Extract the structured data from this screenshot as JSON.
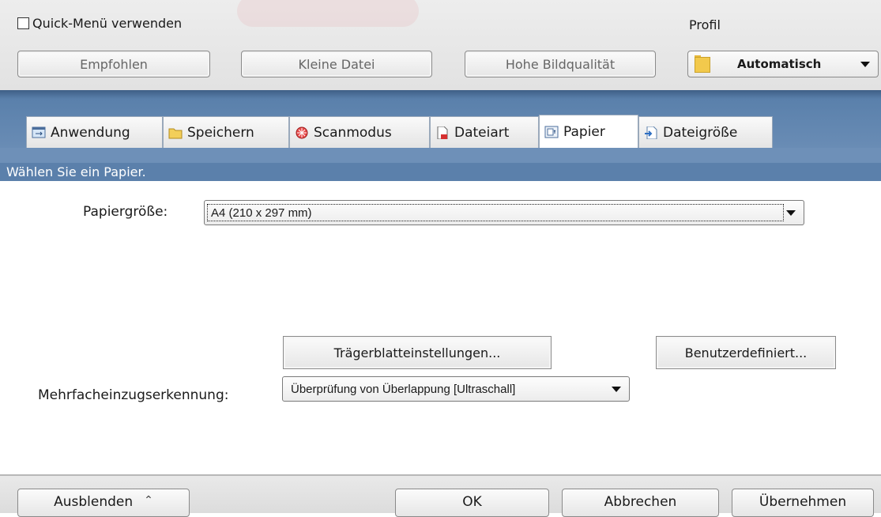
{
  "top": {
    "quick_menu_label": "Quick-Menü verwenden",
    "profile_label": "Profil",
    "presets": [
      "Empfohlen",
      "Kleine Datei",
      "Hohe Bildqualität"
    ],
    "profile_value": "Automatisch"
  },
  "tabs": [
    {
      "label": "Anwendung",
      "icon": "application-icon"
    },
    {
      "label": "Speichern",
      "icon": "folder-icon"
    },
    {
      "label": "Scanmodus",
      "icon": "scanmode-icon"
    },
    {
      "label": "Dateiart",
      "icon": "file-type-icon"
    },
    {
      "label": "Papier",
      "icon": "paper-icon"
    },
    {
      "label": "Dateigröße",
      "icon": "file-size-icon"
    }
  ],
  "active_tab": "Papier",
  "section_heading": "Wählen Sie ein Papier.",
  "paper": {
    "size_label": "Papiergröße:",
    "size_value": "A4 (210 x 297 mm)",
    "carrier_button": "Trägerblatteinstellungen...",
    "custom_button": "Benutzerdefiniert...",
    "multifeed_label": "Mehrfacheinzugserkennung:",
    "multifeed_value": "Überprüfung von Überlappung [Ultraschall]"
  },
  "bottom": {
    "hide": "Ausblenden",
    "ok": "OK",
    "cancel": "Abbrechen",
    "apply": "Übernehmen"
  }
}
